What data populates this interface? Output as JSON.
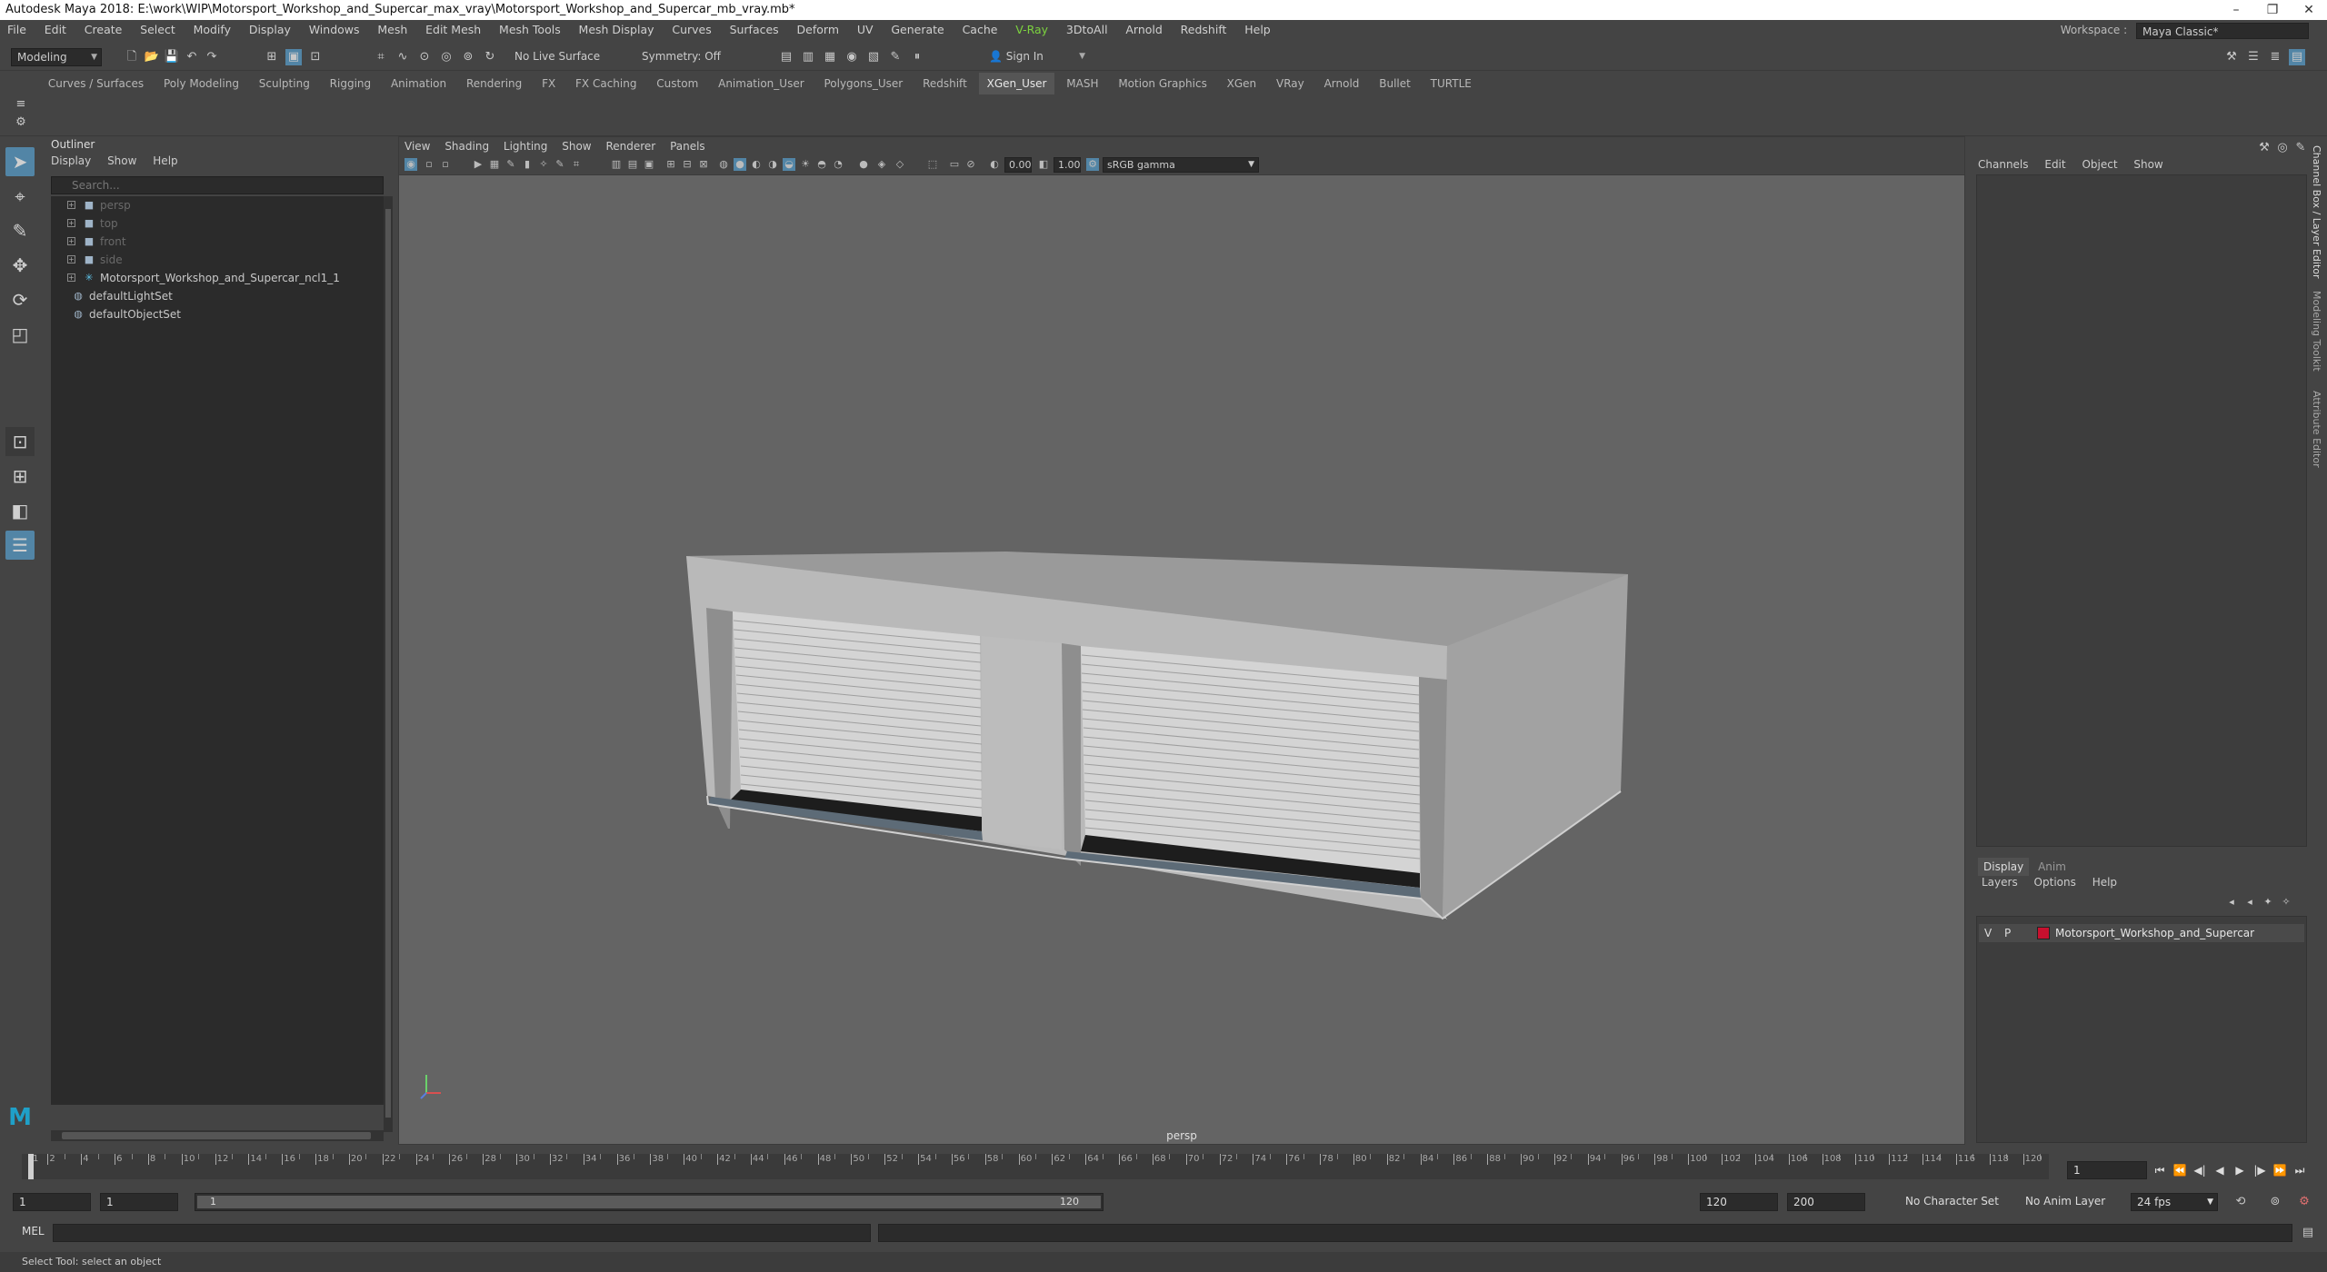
{
  "window": {
    "title": "Autodesk Maya 2018: E:\\work\\WIP\\Motorsport_Workshop_and_Supercar_max_vray\\Motorsport_Workshop_and_Supercar_mb_vray.mb*"
  },
  "menubar": {
    "items": [
      "File",
      "Edit",
      "Create",
      "Select",
      "Modify",
      "Display",
      "Windows",
      "Mesh",
      "Edit Mesh",
      "Mesh Tools",
      "Mesh Display",
      "Curves",
      "Surfaces",
      "Deform",
      "UV",
      "Generate",
      "Cache",
      "V-Ray",
      "3DtoAll",
      "Arnold",
      "Redshift",
      "Help"
    ]
  },
  "workspace": {
    "label": "Workspace :",
    "value": "Maya Classic*"
  },
  "statusline": {
    "mode": "Modeling",
    "live_surface": "No Live Surface",
    "symmetry": "Symmetry: Off",
    "sign_in": "Sign In"
  },
  "shelf": {
    "tabs": [
      "Curves / Surfaces",
      "Poly Modeling",
      "Sculpting",
      "Rigging",
      "Animation",
      "Rendering",
      "FX",
      "FX Caching",
      "Custom",
      "Animation_User",
      "Polygons_User",
      "Redshift",
      "XGen_User",
      "MASH",
      "Motion Graphics",
      "XGen",
      "VRay",
      "Arnold",
      "Bullet",
      "TURTLE"
    ],
    "active": "XGen_User"
  },
  "outliner": {
    "title": "Outliner",
    "menu": [
      "Display",
      "Show",
      "Help"
    ],
    "search_placeholder": "Search...",
    "items": [
      {
        "label": "persp",
        "dim": true,
        "icon": "camera-icon"
      },
      {
        "label": "top",
        "dim": true,
        "icon": "camera-icon"
      },
      {
        "label": "front",
        "dim": true,
        "icon": "camera-icon"
      },
      {
        "label": "side",
        "dim": true,
        "icon": "camera-icon"
      },
      {
        "label": "Motorsport_Workshop_and_Supercar_ncl1_1",
        "dim": false,
        "icon": "group-icon"
      },
      {
        "label": "defaultLightSet",
        "dim": false,
        "icon": "set-icon"
      },
      {
        "label": "defaultObjectSet",
        "dim": false,
        "icon": "set-icon"
      }
    ]
  },
  "viewport": {
    "menu": [
      "View",
      "Shading",
      "Lighting",
      "Show",
      "Renderer",
      "Panels"
    ],
    "exposure": "0.00",
    "gamma": "1.00",
    "color_space": "sRGB gamma",
    "camera": "persp"
  },
  "channelbox": {
    "menu": [
      "Channels",
      "Edit",
      "Object",
      "Show"
    ],
    "layer_tabs": [
      "Display",
      "Anim"
    ],
    "layer_menu": [
      "Layers",
      "Options",
      "Help"
    ],
    "layer": {
      "v": "V",
      "p": "P",
      "name": "Motorsport_Workshop_and_Supercar",
      "color": "#c8102e"
    }
  },
  "sidetabs": [
    "Channel Box / Layer Editor",
    "Modeling Toolkit",
    "Attribute Editor"
  ],
  "timeline": {
    "ticks": [
      "1",
      "2",
      "4",
      "6",
      "8",
      "10",
      "12",
      "14",
      "16",
      "18",
      "20",
      "22",
      "24",
      "26",
      "28",
      "30",
      "32",
      "34",
      "36",
      "38",
      "40",
      "42",
      "44",
      "46",
      "48",
      "50",
      "52",
      "54",
      "56",
      "58",
      "60",
      "62",
      "64",
      "66",
      "68",
      "70",
      "72",
      "74",
      "76",
      "78",
      "80",
      "82",
      "84",
      "86",
      "88",
      "90",
      "92",
      "94",
      "96",
      "98",
      "100",
      "102",
      "104",
      "106",
      "108",
      "110",
      "112",
      "114",
      "116",
      "118",
      "120"
    ],
    "current_frame": "1"
  },
  "range": {
    "start": "1",
    "anim_start": "1",
    "slider_start": "1",
    "slider_end": "120",
    "end": "120",
    "anim_end": "200",
    "character_set": "No Character Set",
    "anim_layer": "No Anim Layer",
    "fps": "24 fps"
  },
  "cmdline": {
    "label": "MEL"
  },
  "helpline": {
    "text": "Select Tool: select an object"
  }
}
